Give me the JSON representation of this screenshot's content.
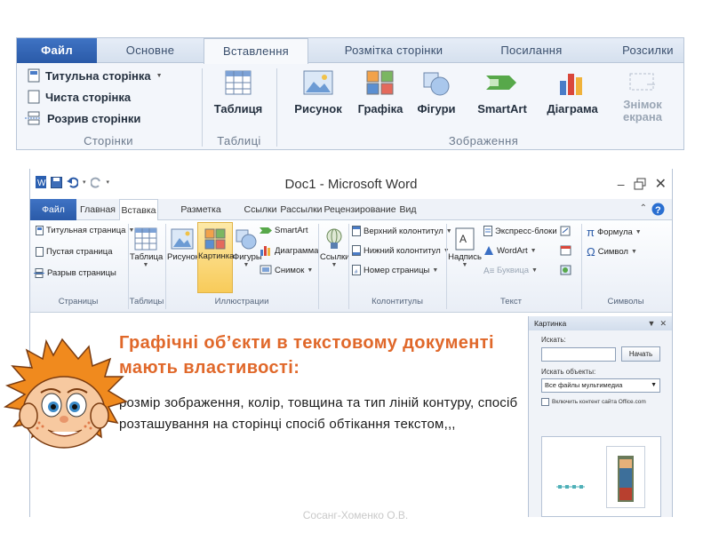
{
  "ribbon_ua": {
    "tabs": [
      "Файл",
      "Основне",
      "Вставлення",
      "Розмітка сторінки",
      "Посилання",
      "Розсилки"
    ],
    "active_tab": "Вставлення",
    "pages_group": {
      "items": [
        "Титульна сторінка",
        "Чиста сторінка",
        "Розрив сторінки"
      ],
      "label": "Сторінки"
    },
    "tables_group": {
      "button": "Таблиця",
      "label": "Таблиці"
    },
    "images_group": {
      "buttons": [
        "Рисунок",
        "Графіка",
        "Фігури",
        "SmartArt",
        "Діаграма",
        "Знімок екрана"
      ],
      "label": "Зображення"
    }
  },
  "word": {
    "title": "Doc1 - Microsoft Word",
    "tabs": [
      "Файл",
      "Главная",
      "Вставка",
      "Разметка страницы",
      "Ссылки",
      "Рассылки",
      "Рецензирование",
      "Вид"
    ],
    "active_tab": "Вставка",
    "groups": {
      "pages": {
        "items": [
          "Титульная страница",
          "Пустая страница",
          "Разрыв страницы"
        ],
        "label": "Страницы"
      },
      "tables": {
        "button": "Таблица",
        "label": "Таблицы"
      },
      "illustrations": {
        "buttons": [
          "Рисунок",
          "Картинка",
          "Фигуры"
        ],
        "small": [
          "SmartArt",
          "Диаграмма",
          "Снимок"
        ],
        "label": "Иллюстрации"
      },
      "links": {
        "button": "Ссылки"
      },
      "headers": {
        "items": [
          "Верхний колонтитул",
          "Нижний колонтитул",
          "Номер страницы"
        ],
        "label": "Колонтитулы"
      },
      "text": {
        "button": "Надпись",
        "items": [
          "Экспресс-блоки",
          "WordArt",
          "Буквица"
        ],
        "label": "Текст"
      },
      "symbols": {
        "items": [
          "Формула",
          "Символ"
        ],
        "label": "Символы"
      }
    },
    "clipart_pane": {
      "title": "Картинка",
      "search_label": "Искать:",
      "search_value": "",
      "search_button": "Начать",
      "objects_label": "Искать объекты:",
      "objects_value": "Все файлы мультимедиа",
      "checkbox_label": "Включить контент сайта Office.com"
    }
  },
  "slide": {
    "heading": "Графічні об’єкти в текстовому документі мають властивості:",
    "body": " розмір зображення, колір, товщина та тип ліній контуру, спосіб розташування на сторінці спосіб обтікання текстом,,,",
    "footer": "Сосанг-Хоменко О.В."
  },
  "colors": {
    "accent": "#e0682a",
    "file_tab": "#2a5aa8"
  }
}
